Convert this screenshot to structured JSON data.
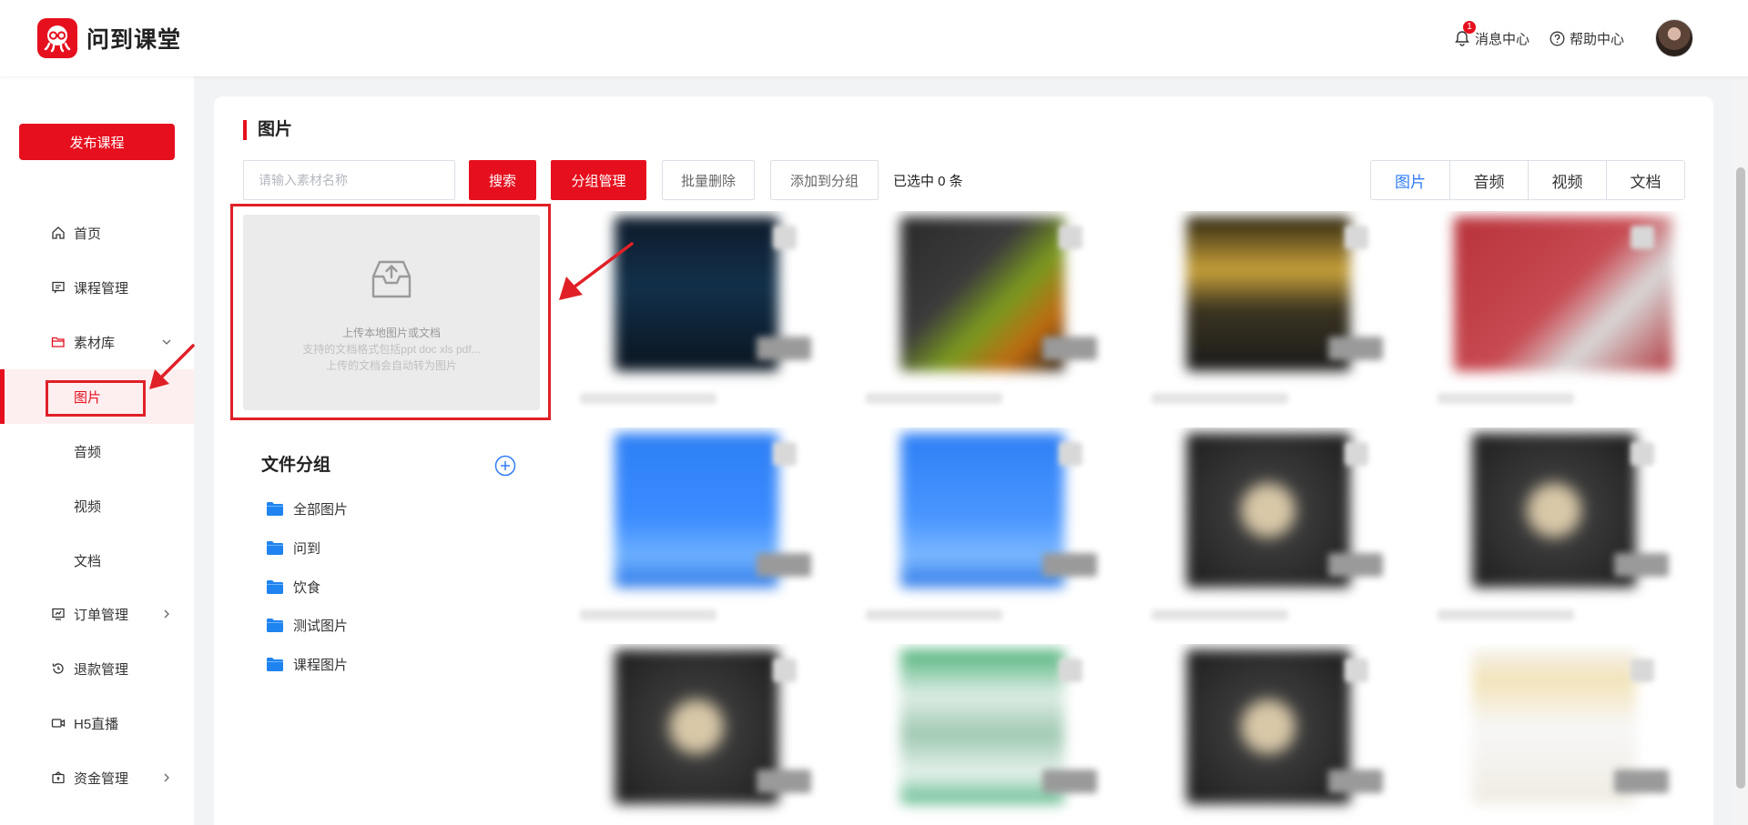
{
  "header": {
    "brand": "问到课堂",
    "messages_label": "消息中心",
    "messages_badge": "1",
    "help_label": "帮助中心"
  },
  "sidebar": {
    "publish_label": "发布课程",
    "items": [
      {
        "label": "首页",
        "icon": "home-icon"
      },
      {
        "label": "课程管理",
        "icon": "course-icon"
      },
      {
        "label": "素材库",
        "icon": "folder-icon",
        "expanded": true
      },
      {
        "label": "图片",
        "active": true
      },
      {
        "label": "音频"
      },
      {
        "label": "视频"
      },
      {
        "label": "文档"
      },
      {
        "label": "订单管理",
        "icon": "order-icon"
      },
      {
        "label": "退款管理",
        "icon": "refund-icon"
      },
      {
        "label": "H5直播",
        "icon": "live-icon"
      },
      {
        "label": "资金管理",
        "icon": "wallet-icon"
      }
    ]
  },
  "main": {
    "title": "图片",
    "search_placeholder": "请输入素材名称",
    "search_label": "搜索",
    "group_manage_label": "分组管理",
    "batch_delete_label": "批量删除",
    "add_to_group_label": "添加到分组",
    "selected_text": "已选中 0 条",
    "type_tabs": [
      "图片",
      "音频",
      "视频",
      "文档"
    ],
    "active_type_tab": 0,
    "upload": {
      "line1": "上传本地图片或文档",
      "line2": "支持的文档格式包括ppt doc xls pdf...",
      "line3": "上传的文档会自动转为图片"
    },
    "groups": {
      "title": "文件分组",
      "items": [
        "全部图片",
        "问到",
        "饮食",
        "测试图片",
        "课程图片"
      ]
    }
  },
  "colors": {
    "brand_red": "#e60f1e",
    "active_blue": "#2f7cf6",
    "folder_blue": "#1f84f0"
  }
}
